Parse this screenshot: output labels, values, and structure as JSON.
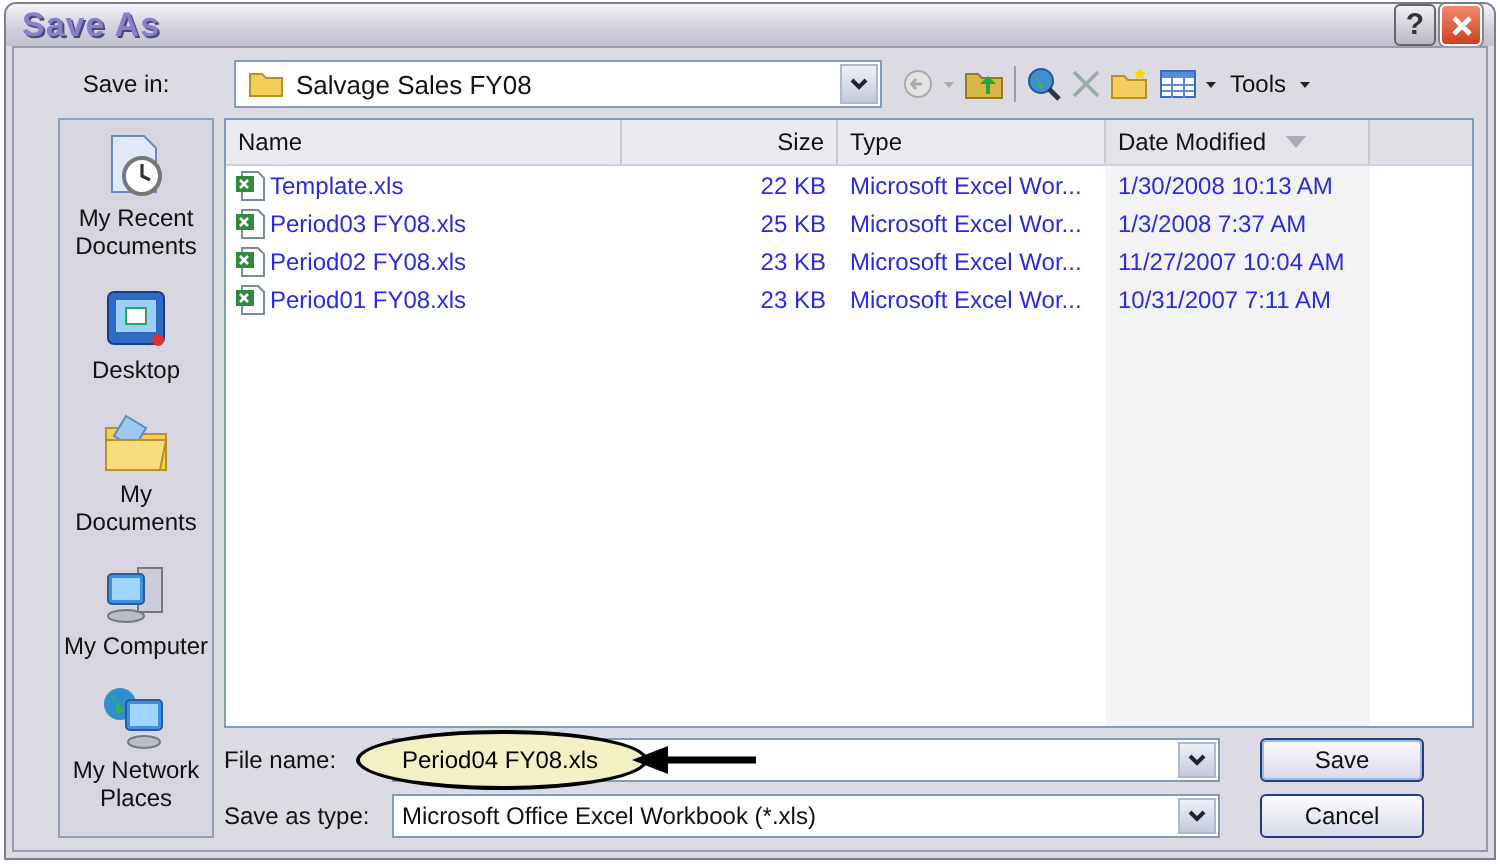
{
  "window": {
    "title": "Save As",
    "help_button": "?"
  },
  "toolbar": {
    "save_in_label": "Save in:",
    "location": "Salvage Sales FY08",
    "tools_menu": "Tools"
  },
  "sidebar": {
    "items": [
      {
        "label": "My Recent Documents",
        "kind": "recent"
      },
      {
        "label": "Desktop",
        "kind": "desktop"
      },
      {
        "label": "My Documents",
        "kind": "documents"
      },
      {
        "label": "My Computer",
        "kind": "computer"
      },
      {
        "label": "My Network Places",
        "kind": "network"
      }
    ]
  },
  "table": {
    "columns": [
      {
        "label": "Name",
        "sorted": false
      },
      {
        "label": "Size",
        "sorted": false
      },
      {
        "label": "Type",
        "sorted": false
      },
      {
        "label": "Date Modified",
        "sorted": true
      }
    ],
    "rows": [
      {
        "name": "Template.xls",
        "size": "22 KB",
        "type": "Microsoft Excel Wor...",
        "date": "1/30/2008 10:13 AM"
      },
      {
        "name": "Period03 FY08.xls",
        "size": "25 KB",
        "type": "Microsoft Excel Wor...",
        "date": "1/3/2008 7:37 AM"
      },
      {
        "name": "Period02 FY08.xls",
        "size": "23 KB",
        "type": "Microsoft Excel Wor...",
        "date": "11/27/2007 10:04 AM"
      },
      {
        "name": "Period01 FY08.xls",
        "size": "23 KB",
        "type": "Microsoft Excel Wor...",
        "date": "10/31/2007 7:11 AM"
      }
    ]
  },
  "file_name": {
    "label": "File name:",
    "value": "Period04 FY08.xls",
    "highlighted": true,
    "arrow": true
  },
  "save_as_type": {
    "label": "Save as type:",
    "value": "Microsoft Office Excel Workbook (*.xls)"
  },
  "buttons": [
    {
      "label": "Save",
      "kind": "default"
    },
    {
      "label": "Cancel",
      "kind": "normal"
    }
  ]
}
